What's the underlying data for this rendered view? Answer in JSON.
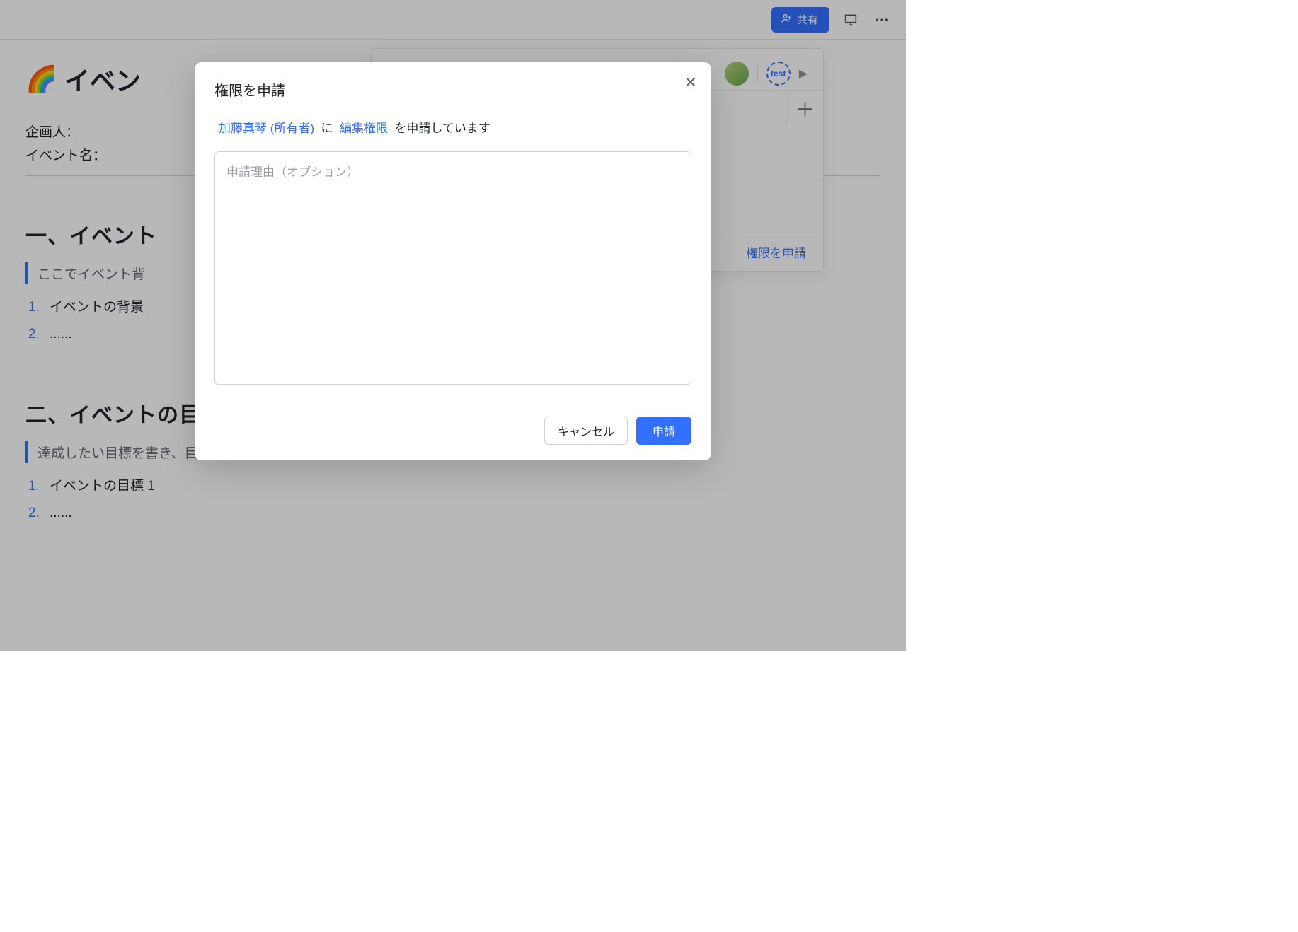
{
  "topbar": {
    "share_label": "共有"
  },
  "doc": {
    "title_emoji": "🌈",
    "title_text": "イベン",
    "meta": {
      "planner_label": "企画人：",
      "event_name_label": "イベント名："
    },
    "section1": {
      "heading": "一、イベント",
      "quote": "ここでイベント背",
      "items": [
        "イベントの背景",
        "......"
      ]
    },
    "section2": {
      "heading": "二、イベントの目標",
      "quote": "達成したい目標を書き、目標を定量評価するようにおすすめする。@ を入力し、関連 Docs を挿入する",
      "items": [
        "イベントの目標 1",
        "......"
      ]
    }
  },
  "popover": {
    "test_label": "test",
    "footer_link": "権限を申請"
  },
  "modal": {
    "title": "権限を申請",
    "owner_link": "加藤真琴 (所有者)",
    "to_text": "に",
    "perm_link": "編集権限",
    "tail_text": "を申請しています",
    "reason_placeholder": "申請理由（オプション）",
    "cancel_label": "キャンセル",
    "submit_label": "申請"
  }
}
